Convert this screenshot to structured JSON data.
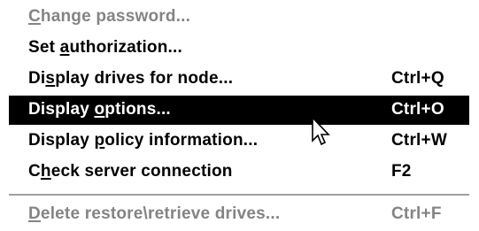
{
  "menu": {
    "items": [
      {
        "pre": "",
        "key": "C",
        "post": "hange password...",
        "shortcut": "",
        "state": "disabled"
      },
      {
        "pre": "Set ",
        "key": "a",
        "post": "uthorization...",
        "shortcut": "",
        "state": "normal"
      },
      {
        "pre": "Di",
        "key": "s",
        "post": "play drives for node...",
        "shortcut": "Ctrl+Q",
        "state": "normal"
      },
      {
        "pre": "Display ",
        "key": "o",
        "post": "ptions...",
        "shortcut": "Ctrl+O",
        "state": "selected"
      },
      {
        "pre": "Display ",
        "key": "p",
        "post": "olicy information...",
        "shortcut": "Ctrl+W",
        "state": "normal"
      },
      {
        "pre": "C",
        "key": "h",
        "post": "eck server connection",
        "shortcut": "F2",
        "state": "normal"
      },
      {
        "pre": "",
        "key": "D",
        "post": "elete restore\\retrieve drives...",
        "shortcut": "Ctrl+F",
        "state": "disabled"
      }
    ]
  },
  "cursor": {
    "icon": "arrow-pointer-icon"
  },
  "colors": {
    "selected_bg": "#000000",
    "selected_fg": "#ffffff",
    "disabled_fg": "#848484",
    "separator": "#a0a0a0"
  }
}
